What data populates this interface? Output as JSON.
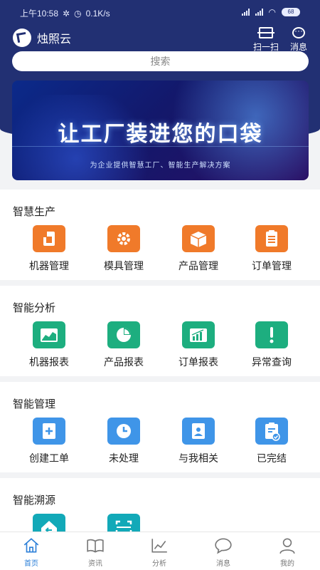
{
  "status_bar": {
    "time": "上午10:58",
    "speed": "0.1K/s",
    "battery": "68"
  },
  "header": {
    "brand": "烛照云",
    "scan_label": "扫一扫",
    "message_label": "消息"
  },
  "search": {
    "placeholder": "搜索"
  },
  "banner": {
    "title": "让工厂装进您的口袋",
    "subtitle": "为企业提供智慧工厂、智能生产解决方案"
  },
  "sections": [
    {
      "title": "智慧生产",
      "color": "#f07a2a",
      "items": [
        {
          "label": "机器管理",
          "icon": "machine-icon"
        },
        {
          "label": "模具管理",
          "icon": "gear-icon"
        },
        {
          "label": "产品管理",
          "icon": "box-icon"
        },
        {
          "label": "订单管理",
          "icon": "clipboard-icon"
        }
      ]
    },
    {
      "title": "智能分析",
      "color": "#1dae7f",
      "items": [
        {
          "label": "机器报表",
          "icon": "area-chart-icon"
        },
        {
          "label": "产品报表",
          "icon": "pie-chart-icon"
        },
        {
          "label": "订单报表",
          "icon": "bar-chart-icon"
        },
        {
          "label": "异常查询",
          "icon": "exclamation-icon"
        }
      ]
    },
    {
      "title": "智能管理",
      "color": "#3f95e8",
      "items": [
        {
          "label": "创建工单",
          "icon": "new-document-icon"
        },
        {
          "label": "未处理",
          "icon": "clock-icon"
        },
        {
          "label": "与我相关",
          "icon": "badge-person-icon"
        },
        {
          "label": "已完结",
          "icon": "checked-clipboard-icon"
        }
      ]
    },
    {
      "title": "智能溯源",
      "color": "#12a9b8",
      "items": [
        {
          "label": "",
          "icon": "home-back-icon"
        },
        {
          "label": "",
          "icon": "scan-frame-icon"
        }
      ]
    }
  ],
  "tabbar": [
    {
      "label": "首页",
      "icon": "home-icon",
      "active": true
    },
    {
      "label": "资讯",
      "icon": "book-icon",
      "active": false
    },
    {
      "label": "分析",
      "icon": "line-chart-icon",
      "active": false
    },
    {
      "label": "消息",
      "icon": "chat-bubble-icon",
      "active": false
    },
    {
      "label": "我的",
      "icon": "user-icon",
      "active": false
    }
  ]
}
